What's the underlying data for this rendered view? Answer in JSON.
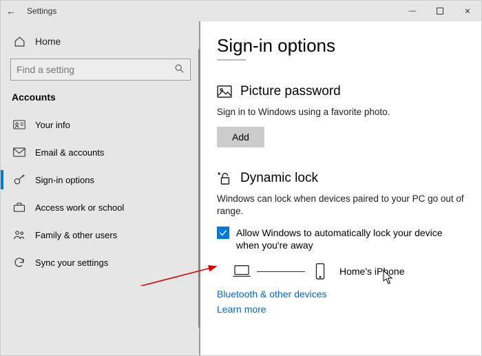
{
  "window": {
    "title": "Settings"
  },
  "sidebar": {
    "home": "Home",
    "search_placeholder": "Find a setting",
    "category": "Accounts",
    "items": [
      {
        "id": "your-info",
        "label": "Your info"
      },
      {
        "id": "email-accounts",
        "label": "Email & accounts"
      },
      {
        "id": "sign-in-options",
        "label": "Sign-in options",
        "selected": true
      },
      {
        "id": "access-work-school",
        "label": "Access work or school"
      },
      {
        "id": "family-other-users",
        "label": "Family & other users"
      },
      {
        "id": "sync-settings",
        "label": "Sync your settings"
      }
    ]
  },
  "main": {
    "title": "Sign-in options",
    "picture_password": {
      "title": "Picture password",
      "desc": "Sign in to Windows using a favorite photo.",
      "button": "Add"
    },
    "dynamic_lock": {
      "title": "Dynamic lock",
      "desc": "Windows can lock when devices paired to your PC go out of range.",
      "checkbox_label": "Allow Windows to automatically lock your device when you're away",
      "checked": true,
      "paired_device": "Home's iPhone",
      "link1": "Bluetooth & other devices",
      "link2": "Learn more"
    }
  }
}
